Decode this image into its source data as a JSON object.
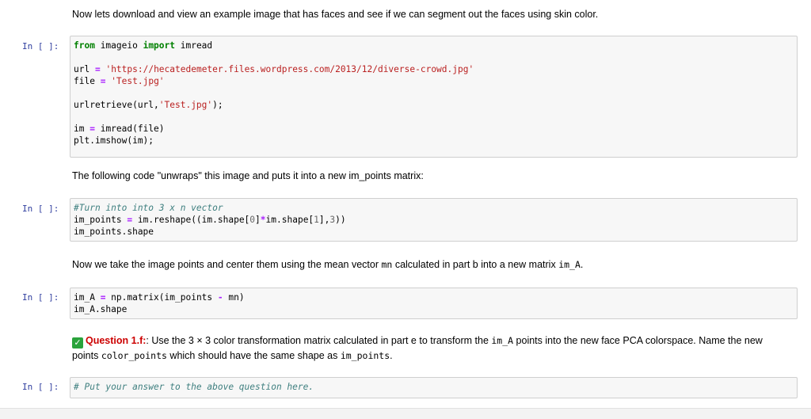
{
  "md1": "Now lets download and view an example image that has faces and see if we can segment out the faces using skin color.",
  "prompt": "In [ ]:",
  "cell1": {
    "l1_kw1": "from",
    "l1_mod": " imageio ",
    "l1_kw2": "import",
    "l1_name": " imread",
    "l2_a": "url ",
    "l2_op": "=",
    "l2_sp": " ",
    "l2_str": "'https://hecatedemeter.files.wordpress.com/2013/12/diverse-crowd.jpg'",
    "l3_a": "file ",
    "l3_op": "=",
    "l3_sp": " ",
    "l3_str": "'Test.jpg'",
    "l4_a": "urlretrieve(url,",
    "l4_str": "'Test.jpg'",
    "l4_b": ");",
    "l5_a": "im ",
    "l5_op": "=",
    "l5_b": " imread(file)",
    "l6": "plt.imshow(im);"
  },
  "md2": "The following code \"unwraps\" this image and puts it into a new im_points matrix:",
  "cell2": {
    "l1_cm": "#Turn into into 3 x n vector",
    "l2_a": "im_points ",
    "l2_op": "=",
    "l2_b": " im.reshape((im.shape[",
    "l2_n1": "0",
    "l2_c": "]",
    "l2_op2": "*",
    "l2_d": "im.shape[",
    "l2_n2": "1",
    "l2_e": "],",
    "l2_n3": "3",
    "l2_f": "))",
    "l3": "im_points.shape"
  },
  "md3": {
    "a": "Now we take the image points and center them using the mean vector ",
    "code1": "mn",
    "b": " calculated in part b into a new matrix ",
    "code2": "im_A",
    "c": "."
  },
  "cell3": {
    "l1_a": "im_A ",
    "l1_op": "=",
    "l1_b": " np.matrix(im_points ",
    "l1_op2": "-",
    "l1_c": " mn)",
    "l2": "im_A.shape"
  },
  "question": {
    "check_icon": "✓",
    "label": "Question 1.f:",
    "a": ": Use the 3 × 3 color transformation matrix calculated in part e to transform the ",
    "code1": "im_A",
    "b": " points into the new face PCA colorspace. Name the new points ",
    "code2": "color_points",
    "c": " which should have the same shape as ",
    "code3": "im_points",
    "d": "."
  },
  "cell4": {
    "l1_cm": "# Put your answer to the above question here."
  }
}
